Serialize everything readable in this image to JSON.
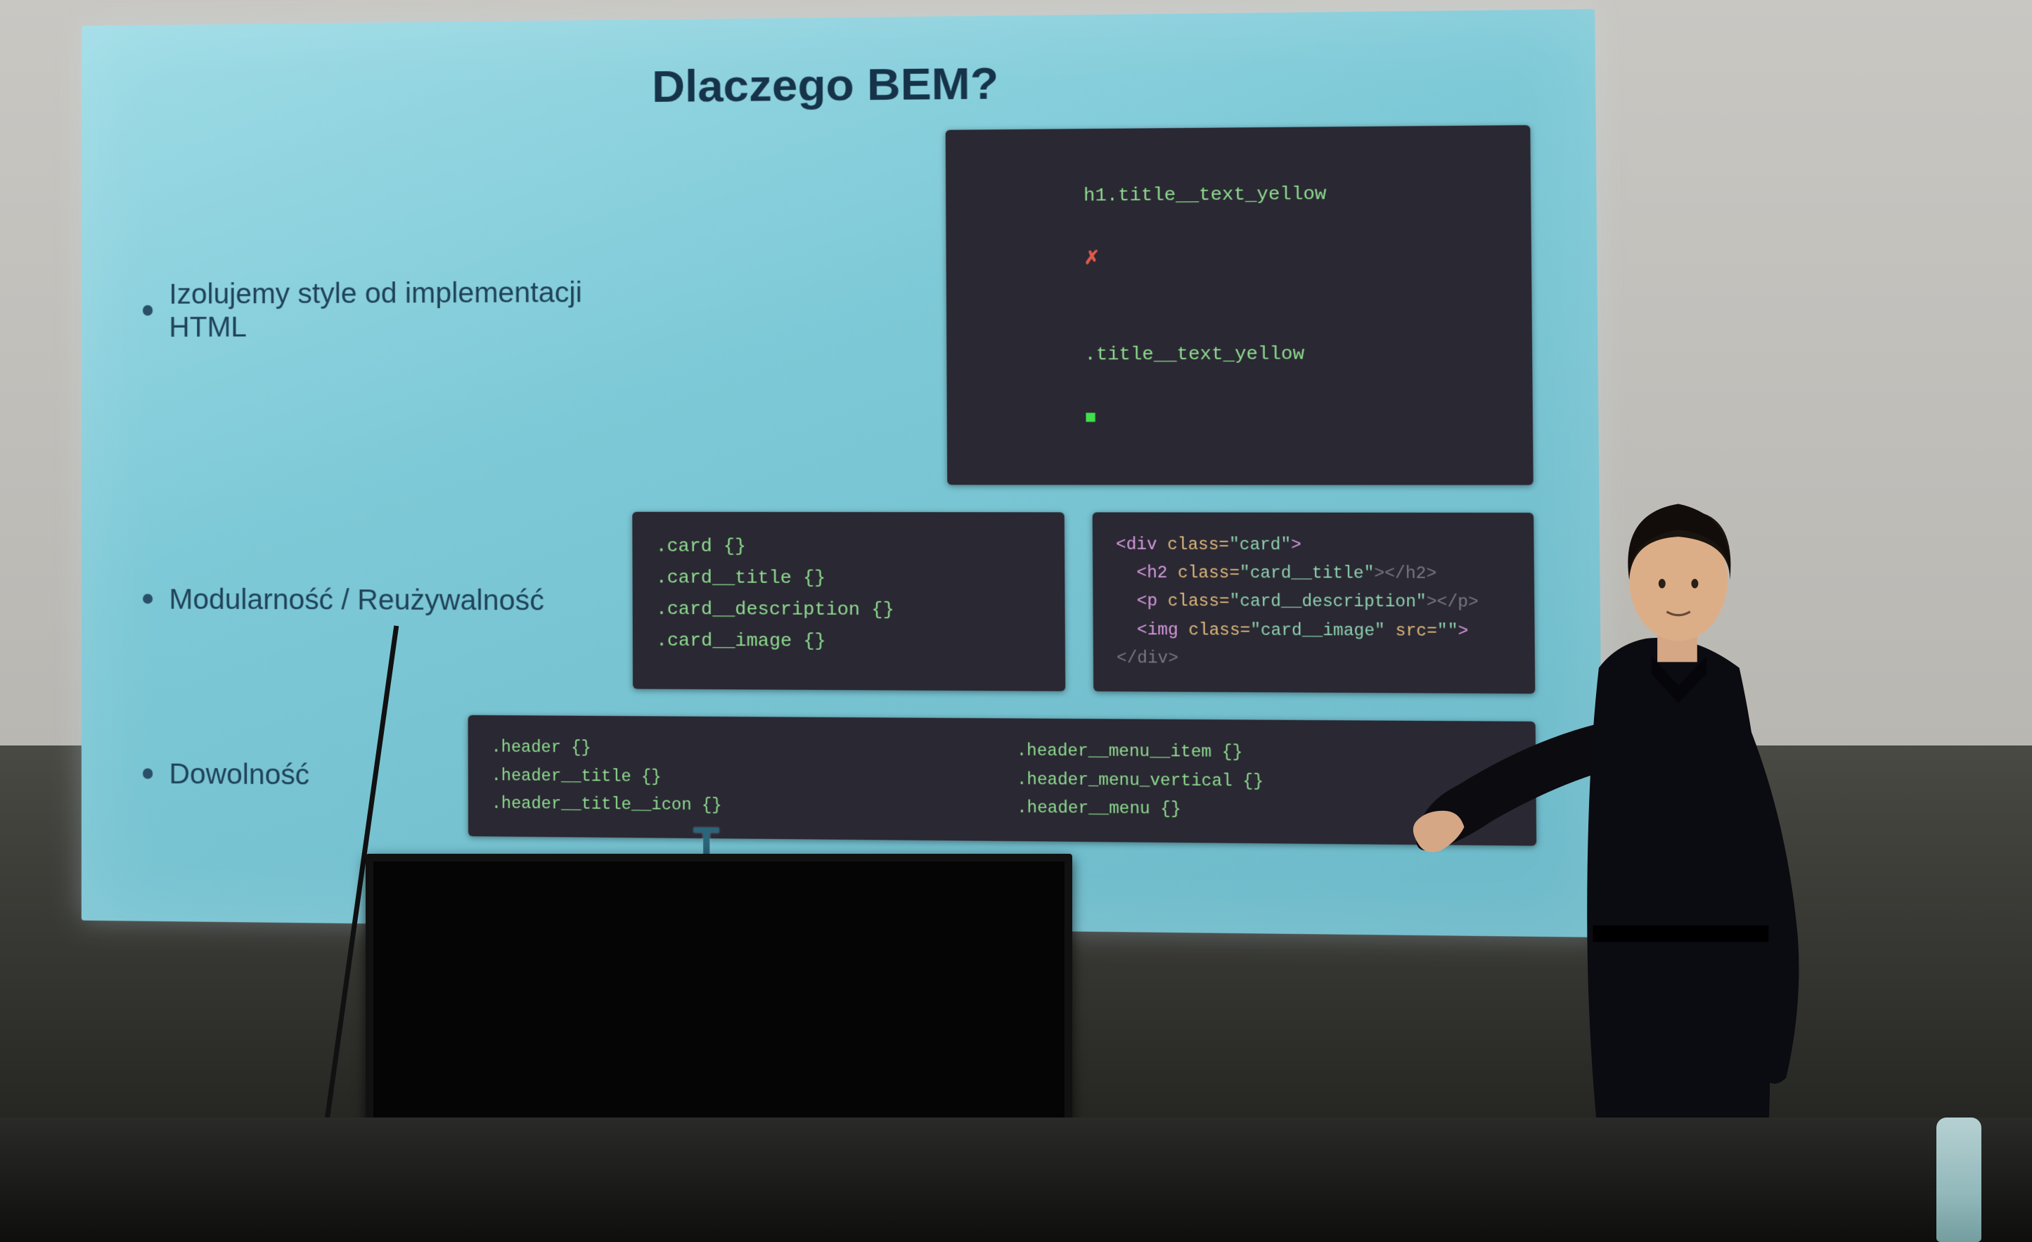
{
  "slide": {
    "title": "Dlaczego BEM?",
    "bullets": {
      "isolate": "Izolujemy style od implementacji HTML",
      "modular": "Modularność / Reużywalność",
      "freedom": "Dowolność"
    },
    "top_box": {
      "bad": "h1.title__text_yellow",
      "good": ".title__text_yellow",
      "bad_mark": "✗",
      "good_mark": "■"
    },
    "mid_left": {
      "l1": ".card {}",
      "l2": ".card__title {}",
      "l3": ".card__description {}",
      "l4": ".card__image {}"
    },
    "mid_right": {
      "l1a": "<div ",
      "l1b": "class=",
      "l1c": "\"card\"",
      "l1d": ">",
      "l2a": "  <h2 ",
      "l2b": "class=",
      "l2c": "\"card__title\"",
      "l2d": "></h2>",
      "l3a": "  <p ",
      "l3b": "class=",
      "l3c": "\"card__description\"",
      "l3d": "></p>",
      "l4a": "  <img ",
      "l4b": "class=",
      "l4c": "\"card__image\" ",
      "l4d": "src=",
      "l4e": "\"\"",
      "l4f": ">",
      "l5": "</div>"
    },
    "bot": {
      "c1l1": ".header {}",
      "c1l2": ".header__title {}",
      "c1l3": ".header__title__icon {}",
      "c2l1": ".header__menu__item {}",
      "c2l2": ".header_menu_vertical {}",
      "c2l3": ".header__menu {}"
    },
    "cursor": "T"
  }
}
